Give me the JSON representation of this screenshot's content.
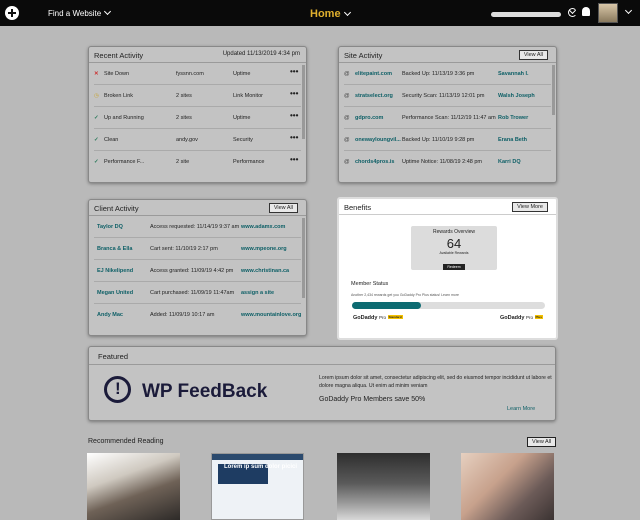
{
  "topbar": {
    "find_label": "Find a Website",
    "home_label": "Home",
    "colors": {
      "bar": "#0a0a0a",
      "accent": "#e0b02e"
    }
  },
  "recent_activity": {
    "title": "Recent Activity",
    "updated": "Updated 11/13/2019 4:34 pm",
    "rows": [
      {
        "status_icon": "x-icon",
        "action": "Site Down",
        "site": "fyssnn.com",
        "category": "Uptime"
      },
      {
        "status_icon": "clock-icon",
        "action": "Broken Link",
        "site": "2 sites",
        "category": "Link Monitor"
      },
      {
        "status_icon": "check-icon",
        "action": "Up and Running",
        "site": "2 sites",
        "category": "Uptime"
      },
      {
        "status_icon": "check-icon",
        "action": "Clean",
        "site": "andy.gov",
        "category": "Security"
      },
      {
        "status_icon": "check-icon",
        "action": "Performance F...",
        "site": "2 site",
        "category": "Performance"
      }
    ]
  },
  "site_activity": {
    "title": "Site Activity",
    "button": "View All",
    "rows": [
      {
        "site": "elitepaint.com",
        "event": "Backed Up: 11/13/19 3:36 pm",
        "user": "Savannah I."
      },
      {
        "site": "stratselect.org",
        "event": "Security Scan: 11/13/19 12:01 pm",
        "user": "Walsh Joseph"
      },
      {
        "site": "gdpro.com",
        "event": "Performance Scan: 11/12/19 11:47 am",
        "user": "Rob Trower"
      },
      {
        "site": "onewayloungvil...",
        "event": "Backed Up: 11/10/19 9:28 pm",
        "user": "Erana Beth"
      },
      {
        "site": "chords4pros.is",
        "event": "Uptime Notice: 11/08/19 2:48 pm",
        "user": "Karri DQ"
      }
    ]
  },
  "client_activity": {
    "title": "Client Activity",
    "button": "View All",
    "rows": [
      {
        "client": "Taylor DQ",
        "event": "Access requested: 11/14/19 9:37 am",
        "site": "www.adamx.com"
      },
      {
        "client": "Branca & Ella",
        "event": "Cart sent: 11/10/19 2:17 pm",
        "site": "www.mpeone.org"
      },
      {
        "client": "EJ Nikelipend",
        "event": "Access granted: 11/09/19 4:42 pm",
        "site": "www.christinan.ca"
      },
      {
        "client": "Megan United",
        "event": "Cart purchased: 11/09/19 11:47am",
        "site": "assign a site"
      },
      {
        "client": "Andy Mac",
        "event": "Added: 11/09/19 10:17 am",
        "site": "www.mountainlove.org"
      }
    ]
  },
  "benefits": {
    "title": "Benefits",
    "button": "View More",
    "rewards_title": "Rewards Overview",
    "rewards_value": "64",
    "rewards_sub": "Available Rewards",
    "rewards_button": "Redeem",
    "member_status": "Member Status",
    "member_note": "Another 2,434 rewards get you GoDaddy Pro Plus status! Learn more",
    "progress": 0.36,
    "tier_left": "GoDaddy",
    "tier_left_suffix": "Pro",
    "tier_left_badge": "Standard",
    "tier_right": "GoDaddy",
    "tier_right_suffix": "Pro",
    "tier_right_badge": "Plus",
    "colors": {
      "progress": "#0d6b72"
    }
  },
  "featured": {
    "title": "Featured",
    "logo_text": "WP FeedBack",
    "description": "Lorem ipsum dolor sit amet, consectetur adipiscing elit, sed do eiusmod tempor incididunt ut labore et dolore magna aliqua. Ut enim ad minim veniam",
    "savings": "GoDaddy Pro Members save 50%",
    "link": "Learn More"
  },
  "recommended": {
    "title": "Recommended Reading",
    "button": "View All",
    "thumb2_text": "Lorem ip sum dolor picici"
  }
}
